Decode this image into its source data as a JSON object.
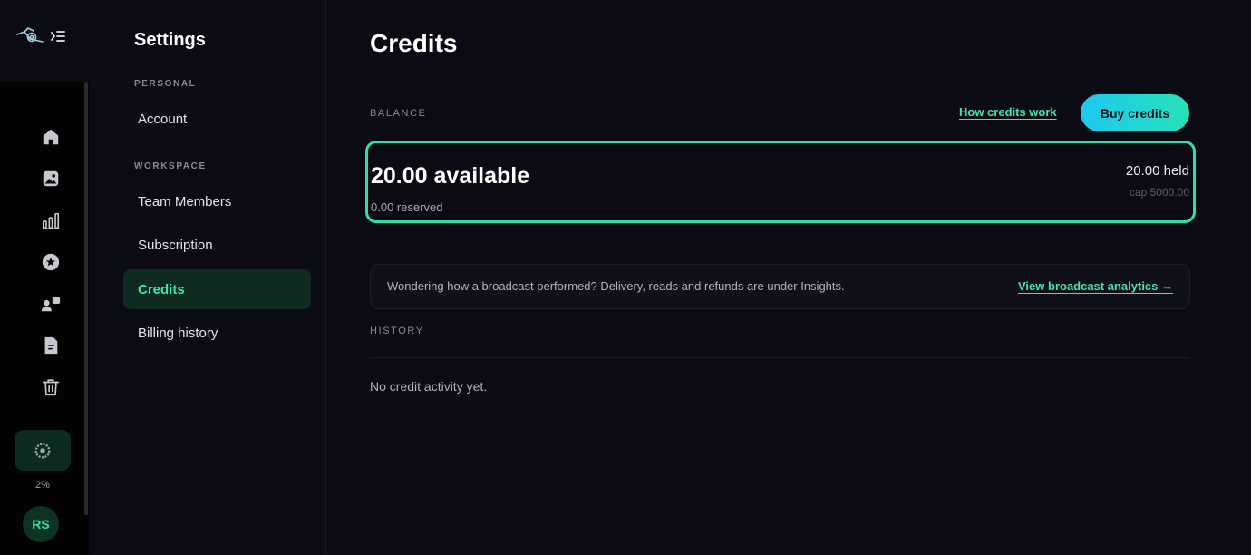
{
  "rail": {
    "usage_percent": "2%",
    "avatar_initials": "RS"
  },
  "settings_nav": {
    "title": "Settings",
    "sections": [
      {
        "label": "PERSONAL",
        "items": [
          {
            "label": "Account"
          }
        ]
      },
      {
        "label": "WORKSPACE",
        "items": [
          {
            "label": "Team Members"
          },
          {
            "label": "Subscription"
          },
          {
            "label": "Credits",
            "active": true
          },
          {
            "label": "Billing history"
          }
        ]
      }
    ]
  },
  "main": {
    "title": "Credits",
    "balance": {
      "label": "BALANCE",
      "how_link": "How credits work",
      "buy_button": "Buy credits",
      "available": "20.00 available",
      "reserved": "0.00 reserved",
      "held": "20.00 held",
      "cap": "cap 5000.00"
    },
    "info": {
      "text": "Wondering how a broadcast performed? Delivery, reads and refunds are under Insights.",
      "link": "View broadcast analytics →"
    },
    "history": {
      "label": "HISTORY",
      "empty_text": "No credit activity yet."
    }
  },
  "colors": {
    "accent": "#3fe6a8",
    "background": "#0b0b14",
    "rail_background": "#030304"
  }
}
